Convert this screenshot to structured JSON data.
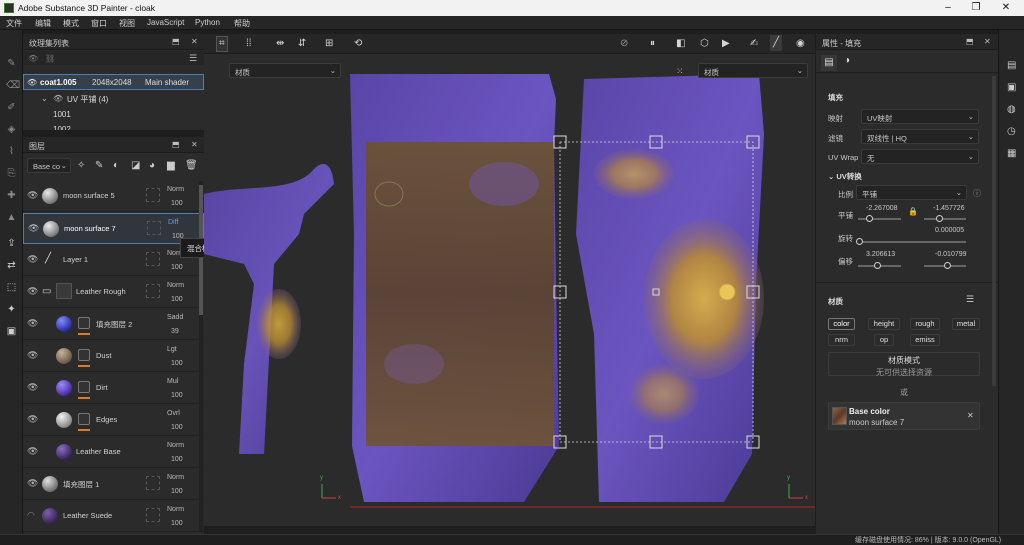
{
  "app": {
    "title": "Adobe Substance 3D Painter - cloak"
  },
  "menu": [
    "文件",
    "编辑",
    "模式",
    "窗口",
    "视图",
    "JavaScript",
    "Python",
    "帮助"
  ],
  "texture_set_panel": {
    "title": "纹理集列表",
    "set_name": "coat1.005",
    "resolution": "2048x2048",
    "shader": "Main shader",
    "uv_group": "UV 平铺 (4)",
    "tiles": [
      "1001",
      "1002"
    ]
  },
  "layers_panel": {
    "title": "图层",
    "channel_dropdown": "Base co",
    "layers": [
      {
        "name": "moon surface 5",
        "blend": "Norm",
        "opacity": "100"
      },
      {
        "name": "moon surface 7",
        "blend": "Diff",
        "opacity": "100"
      },
      {
        "name": "Layer 1",
        "blend": "Norm",
        "opacity": "100"
      },
      {
        "name": "Leather Rough",
        "blend": "Norm",
        "opacity": "100"
      },
      {
        "name": "填充图层 2",
        "blend": "Sadd",
        "opacity": "39"
      },
      {
        "name": "Dust",
        "blend": "Lgt",
        "opacity": "100"
      },
      {
        "name": "Dirt",
        "blend": "Mul",
        "opacity": "100"
      },
      {
        "name": "Edges",
        "blend": "Ovrl",
        "opacity": "100"
      },
      {
        "name": "Leather Base",
        "blend": "Norm",
        "opacity": "100"
      },
      {
        "name": "填充图层 1",
        "blend": "Norm",
        "opacity": "100"
      },
      {
        "name": "Leather Suede",
        "blend": "Norm",
        "opacity": "100"
      }
    ],
    "tooltip": "混合模式"
  },
  "viewport": {
    "left_dropdown": "材质",
    "right_dropdown": "材质",
    "axis_y": "y",
    "axis_x": "x"
  },
  "properties": {
    "title": "属性 - 填充",
    "fill_section": "填充",
    "mapping_label": "映射",
    "mapping_value": "UV映射",
    "filter_label": "滤镜",
    "filter_value": "双线性 | HQ",
    "uvwrap_label": "UV Wrap",
    "uvwrap_value": "无",
    "uv_transform": "UV转换",
    "scale_label": "比例",
    "scale_value": "平铺",
    "tile_label": "平铺",
    "tile_x": "-2.267008",
    "tile_y": "-1.457726",
    "rotate_label": "旋转",
    "rotate_value": "0.000005",
    "offset_label": "偏移",
    "offset_x": "3.206613",
    "offset_y": "-0.010799",
    "material_section": "材质",
    "channels_row1": [
      "color",
      "height",
      "rough",
      "metal"
    ],
    "channels_row2": [
      "nrm",
      "op",
      "emiss"
    ],
    "material_mode": "材质模式",
    "no_resource": "无可供选择资源",
    "or": "或",
    "base_color_label": "Base color",
    "base_color_value": "moon surface 7"
  },
  "status": {
    "text": "缓存磁盘使用情况: 86% | 版本: 9.0.0 (OpenGL)"
  }
}
